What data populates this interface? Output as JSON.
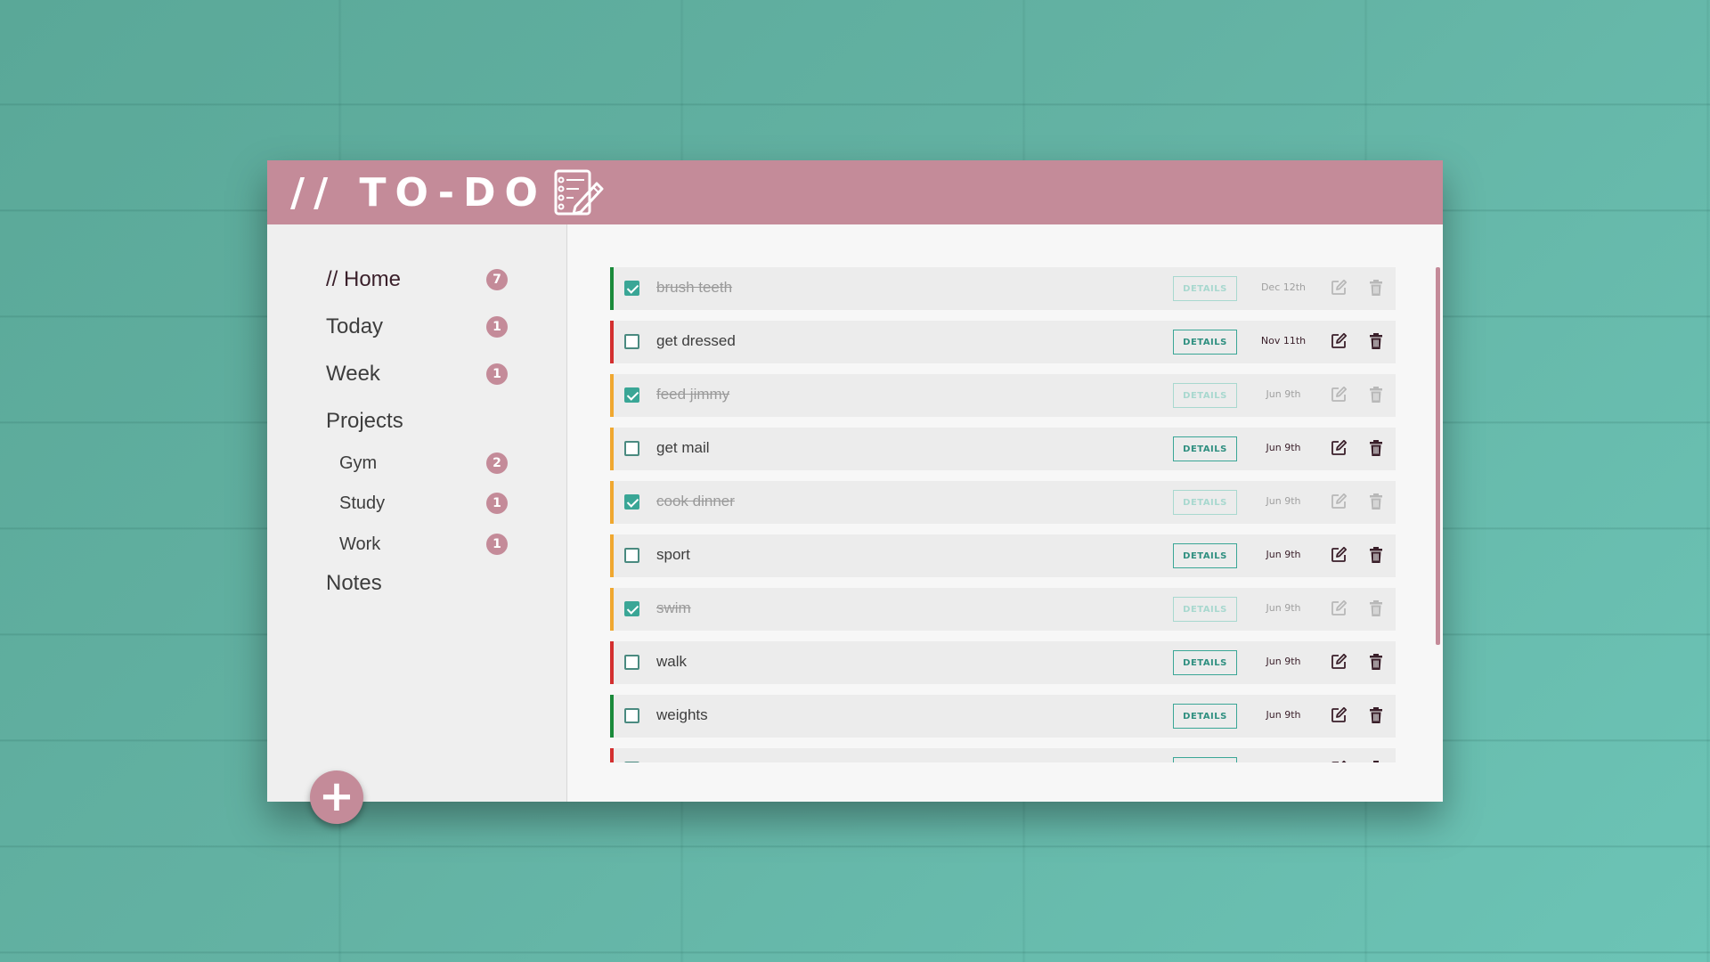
{
  "app": {
    "title": "// TO-DO",
    "accent_color": "#c48b99",
    "logo_icon": "notepad-pencil-icon"
  },
  "sidebar": {
    "items": [
      {
        "label": "// Home",
        "count": "7",
        "active": true
      },
      {
        "label": "Today",
        "count": "1"
      },
      {
        "label": "Week",
        "count": "1"
      },
      {
        "label": "Projects",
        "count": ""
      }
    ],
    "projects": [
      {
        "label": "Gym",
        "count": "2"
      },
      {
        "label": "Study",
        "count": "1"
      },
      {
        "label": "Work",
        "count": "1"
      }
    ],
    "notes_label": "Notes",
    "add_button_label": "+"
  },
  "todos": {
    "details_label": "DETAILS",
    "items": [
      {
        "title": "brush teeth",
        "due": "Dec 12th",
        "done": true,
        "priority": "low",
        "priority_color": "#1a8a3a"
      },
      {
        "title": "get dressed",
        "due": "Nov 11th",
        "done": false,
        "priority": "high",
        "priority_color": "#d32f2f"
      },
      {
        "title": "feed jimmy",
        "due": "Jun 9th",
        "done": true,
        "priority": "medium",
        "priority_color": "#f0a830"
      },
      {
        "title": "get mail",
        "due": "Jun 9th",
        "done": false,
        "priority": "medium",
        "priority_color": "#f0a830"
      },
      {
        "title": "cook dinner",
        "due": "Jun 9th",
        "done": true,
        "priority": "medium",
        "priority_color": "#f0a830"
      },
      {
        "title": "sport",
        "due": "Jun 9th",
        "done": false,
        "priority": "medium",
        "priority_color": "#f0a830"
      },
      {
        "title": "swim",
        "due": "Jun 9th",
        "done": true,
        "priority": "medium",
        "priority_color": "#f0a830"
      },
      {
        "title": "walk",
        "due": "Jun 9th",
        "done": false,
        "priority": "high",
        "priority_color": "#d32f2f"
      },
      {
        "title": "weights",
        "due": "Jun 9th",
        "done": false,
        "priority": "low",
        "priority_color": "#1a8a3a"
      },
      {
        "title": "",
        "due": "",
        "done": false,
        "priority": "high",
        "priority_color": "#d32f2f"
      }
    ]
  }
}
